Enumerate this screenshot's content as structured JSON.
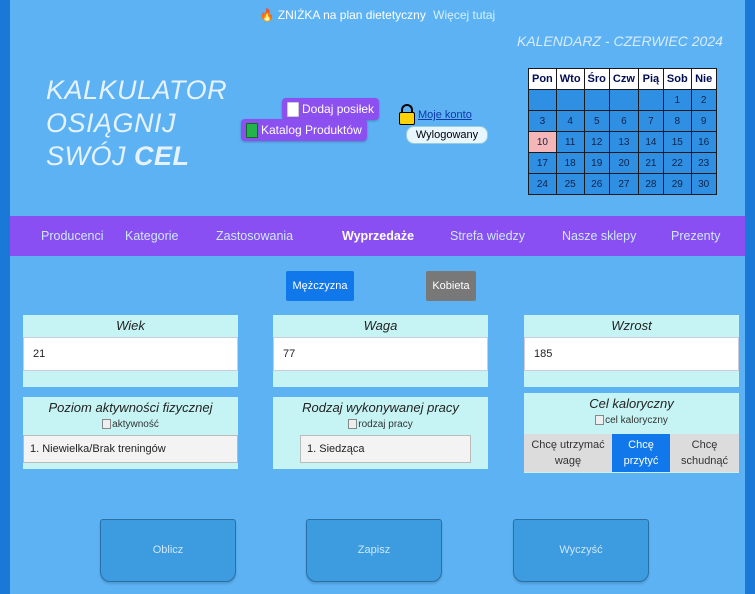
{
  "promo": {
    "text": "ZNIŻKA na plan dietetyczny",
    "link": "Więcej tutaj"
  },
  "logo": {
    "line1": "KALKULATOR",
    "line2": "OSIĄGNIJ",
    "line3_prefix": "SWÓJ ",
    "line3_bold": "CEL"
  },
  "header": {
    "add_meal": "Dodaj posiłek",
    "product_catalog": "Katalog Produktów",
    "account_link": "Moje konto",
    "login_status": "Wylogowany"
  },
  "calendar": {
    "title": "KALENDARZ - CZERWIEC 2024",
    "days": [
      "Pon",
      "Wto",
      "Śro",
      "Czw",
      "Pią",
      "Sob",
      "Nie"
    ],
    "weeks": [
      [
        "",
        "",
        "",
        "",
        "",
        "1",
        "2"
      ],
      [
        "3",
        "4",
        "5",
        "6",
        "7",
        "8",
        "9"
      ],
      [
        "10",
        "11",
        "12",
        "13",
        "14",
        "15",
        "16"
      ],
      [
        "17",
        "18",
        "19",
        "20",
        "21",
        "22",
        "23"
      ],
      [
        "24",
        "25",
        "26",
        "27",
        "28",
        "29",
        "30"
      ]
    ],
    "today": "10"
  },
  "nav": [
    "Producenci",
    "Kategorie",
    "Zastosowania",
    "Wyprzedaże",
    "Strefa wiedzy",
    "Nasze sklepy",
    "Prezenty"
  ],
  "gender": {
    "male": "Mężczyzna",
    "female": "Kobieta"
  },
  "age": {
    "label": "Wiek",
    "value": "21"
  },
  "weight": {
    "label": "Waga",
    "value": "77"
  },
  "height": {
    "label": "Wzrost",
    "value": "185"
  },
  "activity": {
    "label": "Poziom aktywności fizycznej",
    "img_alt": "aktywność",
    "selected": "1. Niewielka/Brak treningów"
  },
  "work": {
    "label": "Rodzaj wykonywanej pracy",
    "img_alt": "rodzaj pracy",
    "selected": "1. Siedząca"
  },
  "goal": {
    "label": "Cel kaloryczny",
    "img_alt": "cel kaloryczny",
    "options": [
      "Chcę utrzymać wagę",
      "Chcę przytyć",
      "Chcę schudnąć"
    ]
  },
  "actions": {
    "calculate": "Oblicz",
    "save": "Zapisz",
    "clear": "Wyczyść"
  },
  "colors": {
    "page_bg": "#5db2f4",
    "nav_bg": "#8a4ff2",
    "accent_blue": "#1078ea",
    "card_bg": "#c6f4f4"
  }
}
